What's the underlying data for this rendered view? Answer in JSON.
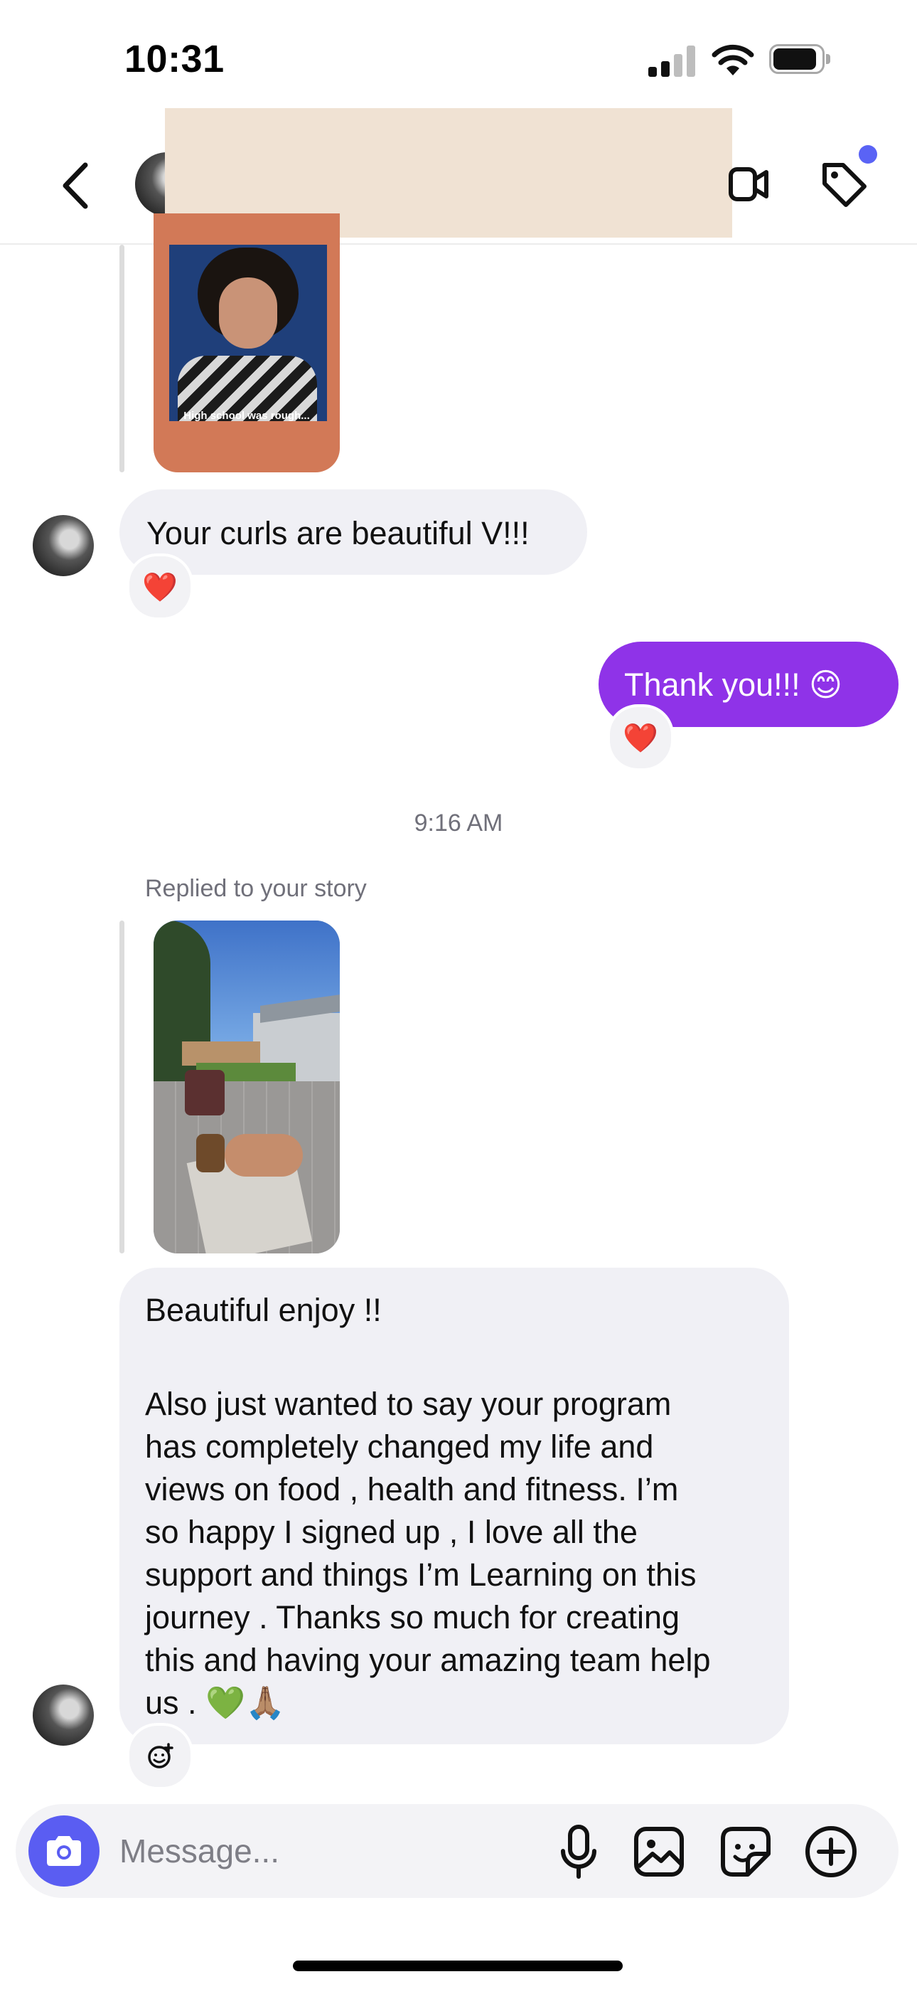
{
  "status_bar": {
    "time": "10:31"
  },
  "messages": {
    "story1_caption": "High school was rough...",
    "incoming1_text": "Your curls are beautiful V!!!",
    "incoming1_reaction": "❤️",
    "outgoing1_text": "Thank you!!! 😊",
    "outgoing1_reaction": "❤️",
    "timestamp": "9:16 AM",
    "replied_label": "Replied to your story",
    "incoming2_line1": "Beautiful enjoy !!",
    "incoming2_para": "Also just wanted to say your program\nhas completely changed my life and\nviews on food , health and fitness. I’m\nso happy I signed up , I love all the\nsupport and things I’m Learning on this\njourney . Thanks so much for creating\nthis and having your amazing team help\nus . 💚🙏🏽"
  },
  "composer": {
    "placeholder": "Message..."
  },
  "icons": [
    "back-icon",
    "video-call-icon",
    "tag-icon",
    "camera-icon",
    "microphone-icon",
    "gallery-icon",
    "sticker-icon",
    "add-icon",
    "add-reaction-icon"
  ],
  "colors": {
    "outgoing_bubble": "#8f33e8",
    "incoming_bubble": "#f0f0f5",
    "camera_button": "#5a5df2",
    "notification_dot": "#5a63f5"
  }
}
